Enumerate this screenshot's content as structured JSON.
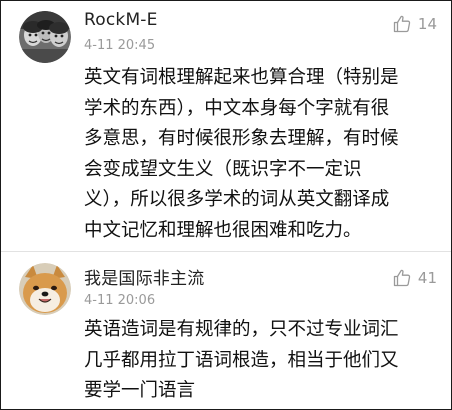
{
  "comments": [
    {
      "username": "RockM-E",
      "timestamp": "4-11 20:45",
      "likes": "14",
      "avatar_icon": "avatar-photo-group",
      "text": "英文有词根理解起来也算合理（特别是\n学术的东西），中文本身每个字就有很\n多意思，有时候很形象去理解，有时候\n会变成望文生义（既识字不一定识\n义），所以很多学术的词从英文翻译成\n中文记忆和理解也很困难和吃力。"
    },
    {
      "username": "我是国际非主流",
      "timestamp": "4-11 20:06",
      "likes": "41",
      "avatar_icon": "avatar-shiba-dog",
      "text": "英语造词是有规律的，只不过专业词汇\n几乎都用拉丁语词根造，相当于他们又\n要学一门语言"
    }
  ],
  "colors": {
    "meta_gray": "#9a9a9a",
    "body_text": "#111111",
    "divider": "#e2e2e2"
  }
}
